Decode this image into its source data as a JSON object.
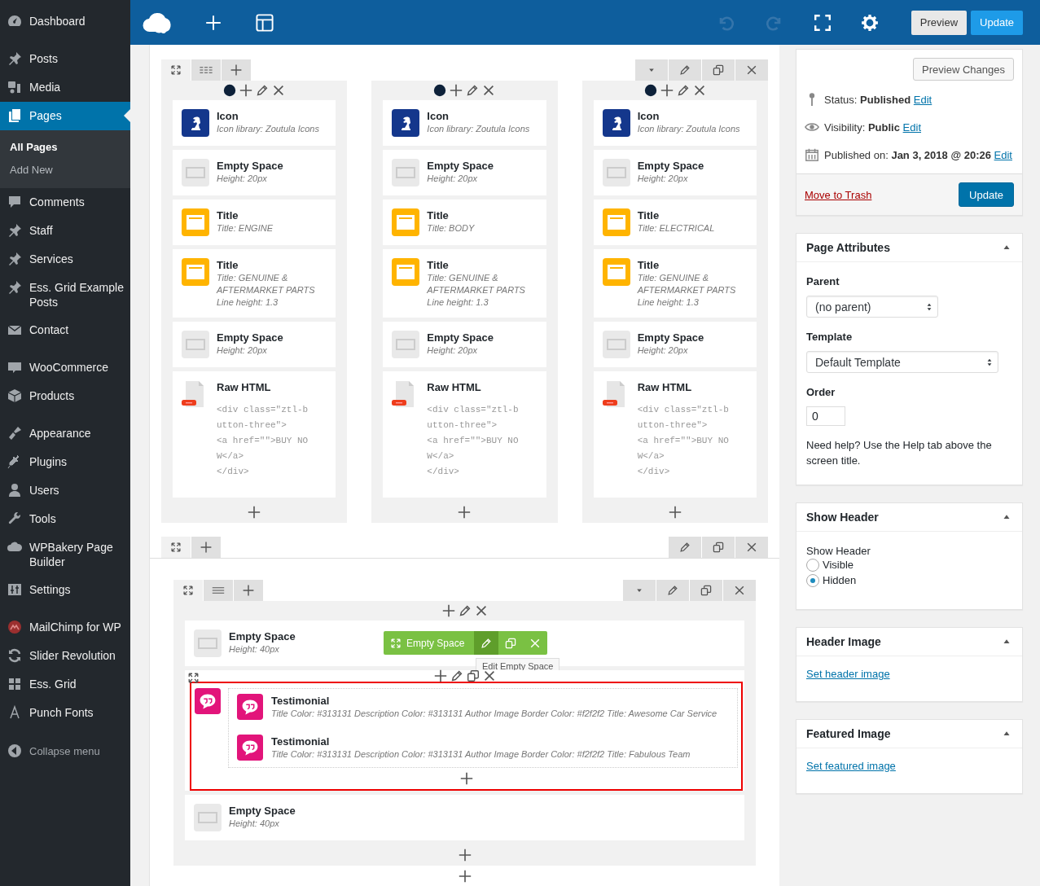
{
  "sidebar": {
    "groups": [
      [
        {
          "label": "Dashboard",
          "selected": false
        }
      ],
      [
        {
          "label": "Posts",
          "selected": false
        },
        {
          "label": "Media",
          "selected": false
        },
        {
          "label": "Pages",
          "selected": true,
          "children": [
            {
              "label": "All Pages",
              "selected": true
            },
            {
              "label": "Add New",
              "selected": false
            }
          ]
        },
        {
          "label": "Comments",
          "selected": false
        },
        {
          "label": "Staff",
          "selected": false
        },
        {
          "label": "Services",
          "selected": false
        },
        {
          "label": "Ess. Grid Example Posts",
          "selected": false
        },
        {
          "label": "Contact",
          "selected": false
        }
      ],
      [
        {
          "label": "WooCommerce",
          "selected": false
        },
        {
          "label": "Products",
          "selected": false
        }
      ],
      [
        {
          "label": "Appearance",
          "selected": false
        },
        {
          "label": "Plugins",
          "selected": false
        },
        {
          "label": "Users",
          "selected": false
        },
        {
          "label": "Tools",
          "selected": false
        },
        {
          "label": "WPBakery Page Builder",
          "selected": false
        },
        {
          "label": "Settings",
          "selected": false
        }
      ],
      [
        {
          "label": "MailChimp for WP",
          "selected": false
        },
        {
          "label": "Slider Revolution",
          "selected": false
        },
        {
          "label": "Ess. Grid",
          "selected": false
        },
        {
          "label": "Punch Fonts",
          "selected": false
        }
      ]
    ],
    "collapse_label": "Collapse menu"
  },
  "toolbar": {
    "history": [
      {
        "disabled": true
      },
      {
        "disabled": true
      }
    ],
    "preview_button": "Preview",
    "update_button": "Update"
  },
  "builder": {
    "top_row": {
      "columns": [
        {
          "elements": [
            {
              "kind": "icon",
              "name": "Icon",
              "detail": "Icon library: Zoutula Icons"
            },
            {
              "kind": "space",
              "name": "Empty Space",
              "detail": "Height: 20px"
            },
            {
              "kind": "title",
              "name": "Title",
              "detail": "Title: ENGINE"
            },
            {
              "kind": "title",
              "name": "Title",
              "detail": "Title: GENUINE & AFTERMARKET PARTS Line height: 1.3"
            },
            {
              "kind": "space",
              "name": "Empty Space",
              "detail": "Height: 20px"
            },
            {
              "kind": "html",
              "name": "Raw HTML",
              "code": "<div class=\"ztl-button-three\">\n<a href=\"\">BUY NOW</a>\n</div>"
            }
          ]
        },
        {
          "elements": [
            {
              "kind": "icon",
              "name": "Icon",
              "detail": "Icon library: Zoutula Icons"
            },
            {
              "kind": "space",
              "name": "Empty Space",
              "detail": "Height: 20px"
            },
            {
              "kind": "title",
              "name": "Title",
              "detail": "Title: BODY"
            },
            {
              "kind": "title",
              "name": "Title",
              "detail": "Title: GENUINE & AFTERMARKET PARTS Line height: 1.3"
            },
            {
              "kind": "space",
              "name": "Empty Space",
              "detail": "Height: 20px"
            },
            {
              "kind": "html",
              "name": "Raw HTML",
              "code": "<div class=\"ztl-button-three\">\n<a href=\"\">BUY NOW</a>\n</div>"
            }
          ]
        },
        {
          "elements": [
            {
              "kind": "icon",
              "name": "Icon",
              "detail": "Icon library: Zoutula Icons"
            },
            {
              "kind": "space",
              "name": "Empty Space",
              "detail": "Height: 20px"
            },
            {
              "kind": "title",
              "name": "Title",
              "detail": "Title: ELECTRICAL"
            },
            {
              "kind": "title",
              "name": "Title",
              "detail": "Title: GENUINE & AFTERMARKET PARTS Line height: 1.3"
            },
            {
              "kind": "space",
              "name": "Empty Space",
              "detail": "Height: 20px"
            },
            {
              "kind": "html",
              "name": "Raw HTML",
              "code": "<div class=\"ztl-button-three\">\n<a href=\"\">BUY NOW</a>\n</div>"
            }
          ]
        }
      ]
    },
    "bottom_row": {
      "elements": [
        {
          "kind": "space",
          "name": "Empty Space",
          "detail": "Height: 40px",
          "hover_toolbar": {
            "label": "Empty Space",
            "tooltip": "Edit Empty Space"
          }
        },
        {
          "kind": "container",
          "highlighted": true,
          "items": [
            {
              "kind": "testimonial",
              "name": "Testimonial",
              "detail": "Title Color: #313131  Description Color: #313131  Author Image Border Color: #f2f2f2  Title: Awesome Car Service"
            },
            {
              "kind": "testimonial",
              "name": "Testimonial",
              "detail": "Title Color: #313131  Description Color: #313131  Author Image Border Color: #f2f2f2  Title: Fabulous Team"
            }
          ]
        },
        {
          "kind": "space",
          "name": "Empty Space",
          "detail": "Height: 40px"
        }
      ]
    }
  },
  "publish": {
    "preview_button": "Preview Changes",
    "rows": [
      {
        "text": "Status: **Published**",
        "link": "Edit"
      },
      {
        "text": "Visibility: **Public**",
        "link": "Edit"
      },
      {
        "text": "Published on: **Jan 3, 2018 @ 20:26**",
        "link": "Edit"
      }
    ],
    "trash_link": "Move to Trash",
    "update_button": "Update"
  },
  "page_attributes": {
    "title": "Page Attributes",
    "parent_label": "Parent",
    "parent_value": "(no parent)",
    "template_label": "Template",
    "template_value": "Default Template",
    "order_label": "Order",
    "order_value": "0",
    "help": "Need help? Use the Help tab above the screen title."
  },
  "show_header": {
    "title": "Show Header",
    "label": "Show Header",
    "options": [
      {
        "label": "Visible",
        "selected": false
      },
      {
        "label": "Hidden",
        "selected": true
      }
    ]
  },
  "header_image": {
    "title": "Header Image",
    "link": "Set header image"
  },
  "featured_image": {
    "title": "Featured Image",
    "link": "Set featured image"
  }
}
